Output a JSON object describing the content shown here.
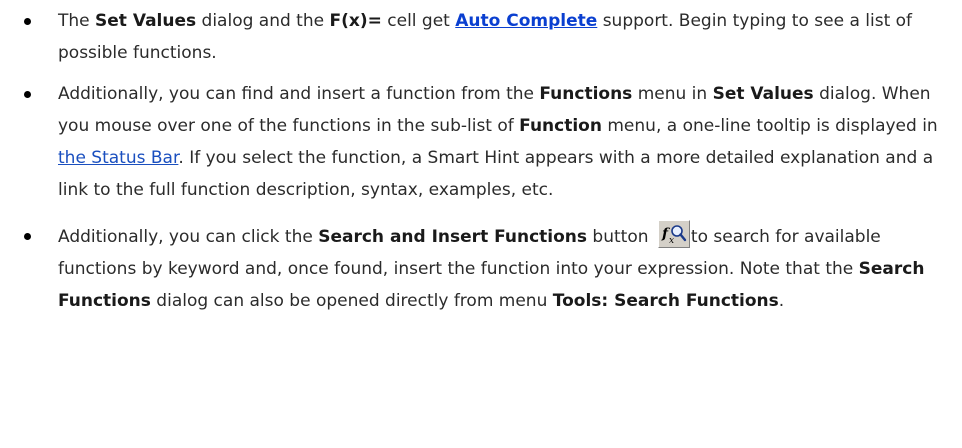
{
  "bullets": [
    {
      "t1": "The ",
      "b1": "Set Values",
      "t2": " dialog and the ",
      "b2": "F(x)=",
      "t3": " cell get ",
      "link": "Auto Complete",
      "t4": " support. Begin typing to see a list of possible functions."
    },
    {
      "t1": "Additionally, you can find and insert a function from the ",
      "b1": "Functions",
      "t2": " menu in ",
      "b2": "Set Values",
      "t3": " dialog. When you mouse over one of the functions in the sub-list of ",
      "b3": "Function",
      "t4": " menu, a one-line tooltip is displayed in ",
      "link": "the Status Bar",
      "t5": ". If you select the function, a Smart Hint appears with a more detailed explanation and a link to the full function description, syntax, examples, etc."
    },
    {
      "t1": "Additionally, you can click the ",
      "b1": "Search and Insert Functions",
      "t2": " button ",
      "icon": "search-functions-icon",
      "t3": "to search for available functions by keyword and, once found, insert the function into your expression. Note that the ",
      "b2": "Search Functions",
      "t4": " dialog can also be opened directly from menu ",
      "b3": "Tools: Search Functions",
      "t5": "."
    }
  ],
  "colors": {
    "text": "#2b2b2b",
    "link": "#1a4fbf",
    "link_bold": "#0a3fd0",
    "bullet": "#000000"
  }
}
